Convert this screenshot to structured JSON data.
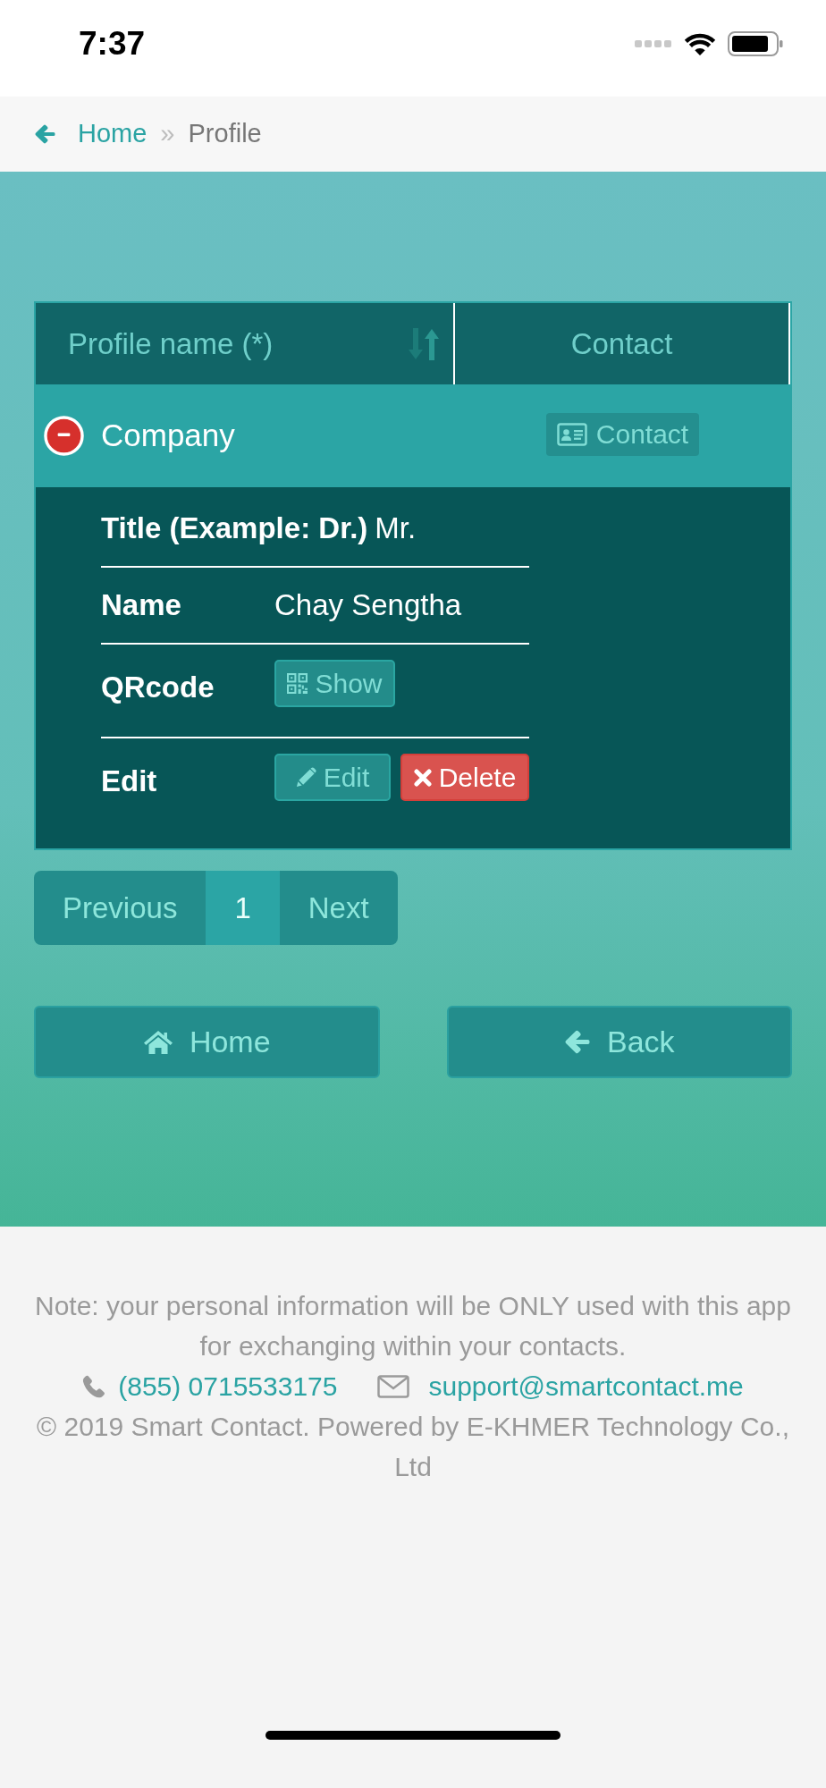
{
  "status_bar": {
    "time": "7:37"
  },
  "breadcrumb": {
    "items": [
      {
        "label": "Home",
        "selected": false
      },
      {
        "label": "Profile",
        "selected": true
      }
    ],
    "separator": "»"
  },
  "table": {
    "columns": [
      {
        "label": "Profile name (*)",
        "sortable": true
      },
      {
        "label": "Contact"
      }
    ],
    "rows": [
      {
        "name": "Company",
        "expanded": true,
        "contact": "Contact",
        "details": [
          {
            "kind": "field",
            "label": "Title (Example: Dr.)",
            "value": "Mr."
          },
          {
            "kind": "field",
            "label": "Name",
            "value": "Chay Sengtha"
          },
          {
            "kind": "actions",
            "label": "QRcode",
            "buttons": [
              {
                "kind": "qrcode",
                "label": "Show"
              }
            ]
          },
          {
            "kind": "actions",
            "label": "Edit",
            "buttons": [
              {
                "kind": "edit",
                "label": "Edit"
              },
              {
                "kind": "delete",
                "label": "Delete"
              }
            ]
          }
        ]
      }
    ]
  },
  "pagination": {
    "previous": "Previous",
    "pages": [
      {
        "label": "1",
        "selected": true
      }
    ],
    "next": "Next"
  },
  "actions": [
    {
      "kind": "home",
      "label": "Home"
    },
    {
      "kind": "back",
      "label": "Back"
    }
  ],
  "footer": {
    "note": "Note: your personal information will be ONLY used with this app for exchanging within your contacts.",
    "phone": "(855) 0715533175",
    "email": "support@smartcontact.me",
    "copyright": "© 2019 Smart Contact. Powered by E-KHMER Technology Co., Ltd"
  }
}
